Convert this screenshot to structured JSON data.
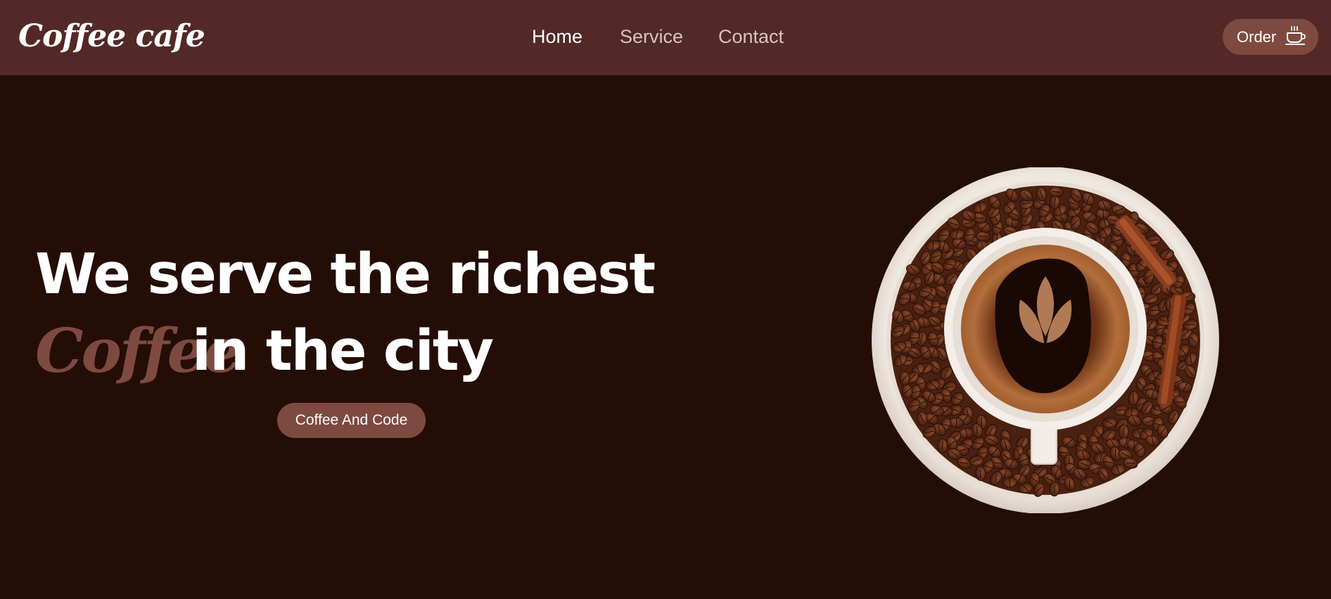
{
  "nav": {
    "logo": "Coffee cafe",
    "links": [
      {
        "label": "Home",
        "active": true
      },
      {
        "label": "Service",
        "active": false
      },
      {
        "label": "Contact",
        "active": false
      }
    ],
    "order_button": {
      "label": "Order",
      "icon": "coffee-cup-icon"
    }
  },
  "hero": {
    "line1": "We serve the richest",
    "highlight": "Coffee",
    "line2_rest": "in the city",
    "cta_label": "Coffee And Code",
    "image": "coffee-cup-on-beans-image"
  },
  "colors": {
    "navbar": "#532927",
    "background": "#240d05",
    "accent": "#7e4a40",
    "text": "#ffffff",
    "muted_nav": "#d6c3c0"
  }
}
